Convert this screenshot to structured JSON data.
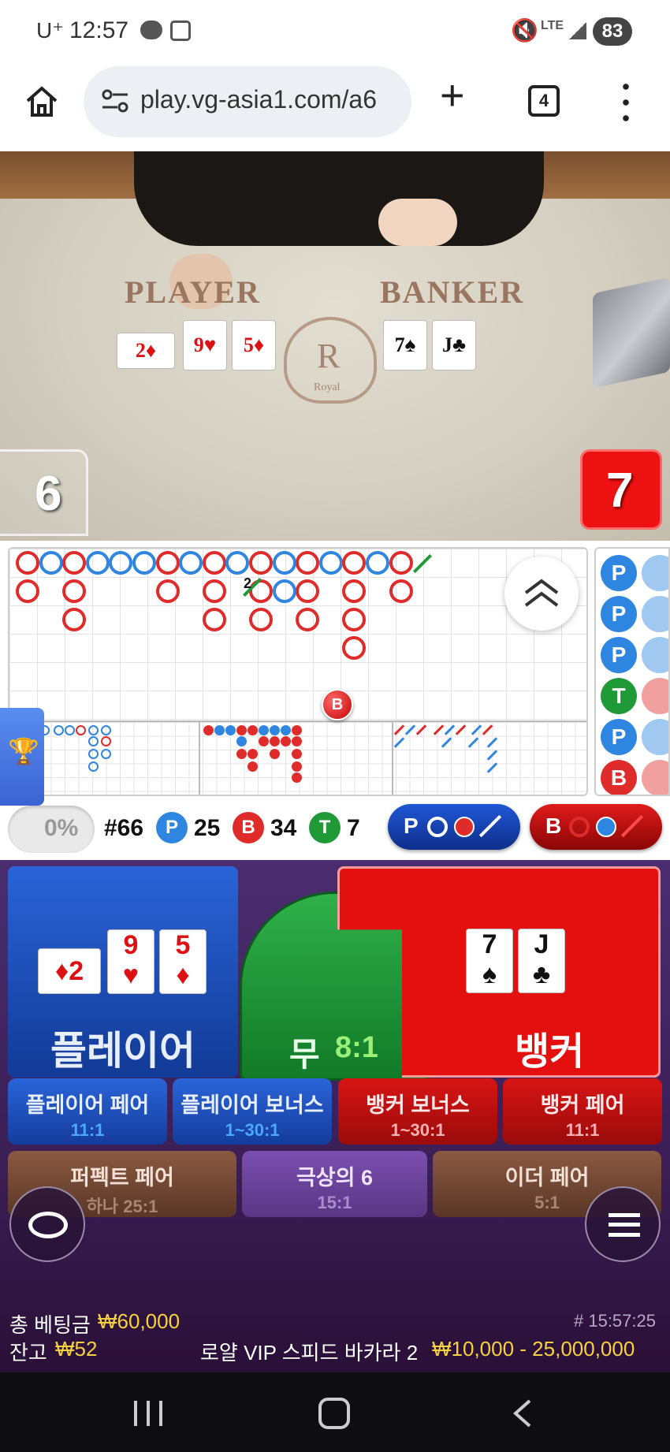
{
  "status_bar": {
    "carrier": "U⁺",
    "time": "12:57",
    "network": "LTE",
    "battery": "83"
  },
  "browser": {
    "url": "play.vg-asia1.com/a6",
    "tab_count": "4"
  },
  "video": {
    "table_labels": {
      "player": "PLAYER",
      "banker": "BANKER"
    },
    "logo_letter": "R",
    "logo_text": "Royal",
    "player_cards": [
      {
        "rank": "2",
        "suit": "♦"
      },
      {
        "rank": "9",
        "suit": "♥"
      },
      {
        "rank": "5",
        "suit": "♦"
      }
    ],
    "banker_cards": [
      {
        "rank": "7",
        "suit": "♠"
      },
      {
        "rank": "J",
        "suit": "♣"
      }
    ],
    "player_score": "6",
    "banker_score": "7"
  },
  "roadmap": {
    "tie_mark": "2",
    "prediction_marker": "B",
    "bead_column": [
      "P",
      "P",
      "P",
      "T",
      "P",
      "B"
    ],
    "stats": {
      "percent": "0%",
      "round": "#66",
      "player_label": "P",
      "player_count": "25",
      "banker_label": "B",
      "banker_count": "34",
      "tie_label": "T",
      "tie_count": "7"
    },
    "ask_buttons": {
      "player": "P",
      "banker": "B"
    }
  },
  "betting": {
    "player": {
      "label": "플레이어",
      "cards": [
        {
          "rank": "2",
          "suit": "♦"
        },
        {
          "rank": "9",
          "suit": "♥"
        },
        {
          "rank": "5",
          "suit": "♦"
        }
      ]
    },
    "tie": {
      "label": "무",
      "odds": "8:1"
    },
    "banker": {
      "label": "뱅커",
      "cards": [
        {
          "rank": "7",
          "suit": "♠"
        },
        {
          "rank": "J",
          "suit": "♣"
        }
      ]
    },
    "side_bets": [
      {
        "label": "플레이어 페어",
        "odds": "11:1"
      },
      {
        "label": "플레이어 보너스",
        "odds": "1~30:1"
      },
      {
        "label": "뱅커 보너스",
        "odds": "1~30:1"
      },
      {
        "label": "뱅커 페어",
        "odds": "11:1"
      },
      {
        "label": "퍼펙트 페어",
        "odds": "하나 25:1"
      },
      {
        "label": "극상의 6",
        "odds": "15:1"
      },
      {
        "label": "이더 페어",
        "odds": "5:1"
      }
    ]
  },
  "footer": {
    "total_bet_label": "총 베팅금",
    "total_bet_value": "₩60,000",
    "game_time": "# 15:57:25",
    "balance_label": "잔고",
    "balance_value": "₩52",
    "table_name": "로얄 VIP 스피드 바카라 2",
    "limits": "₩10,000 - 25,000,000"
  },
  "colors": {
    "player": "#1d4fc4",
    "banker": "#e01414",
    "tie": "#1f9a37",
    "accent": "#f7d23e"
  }
}
